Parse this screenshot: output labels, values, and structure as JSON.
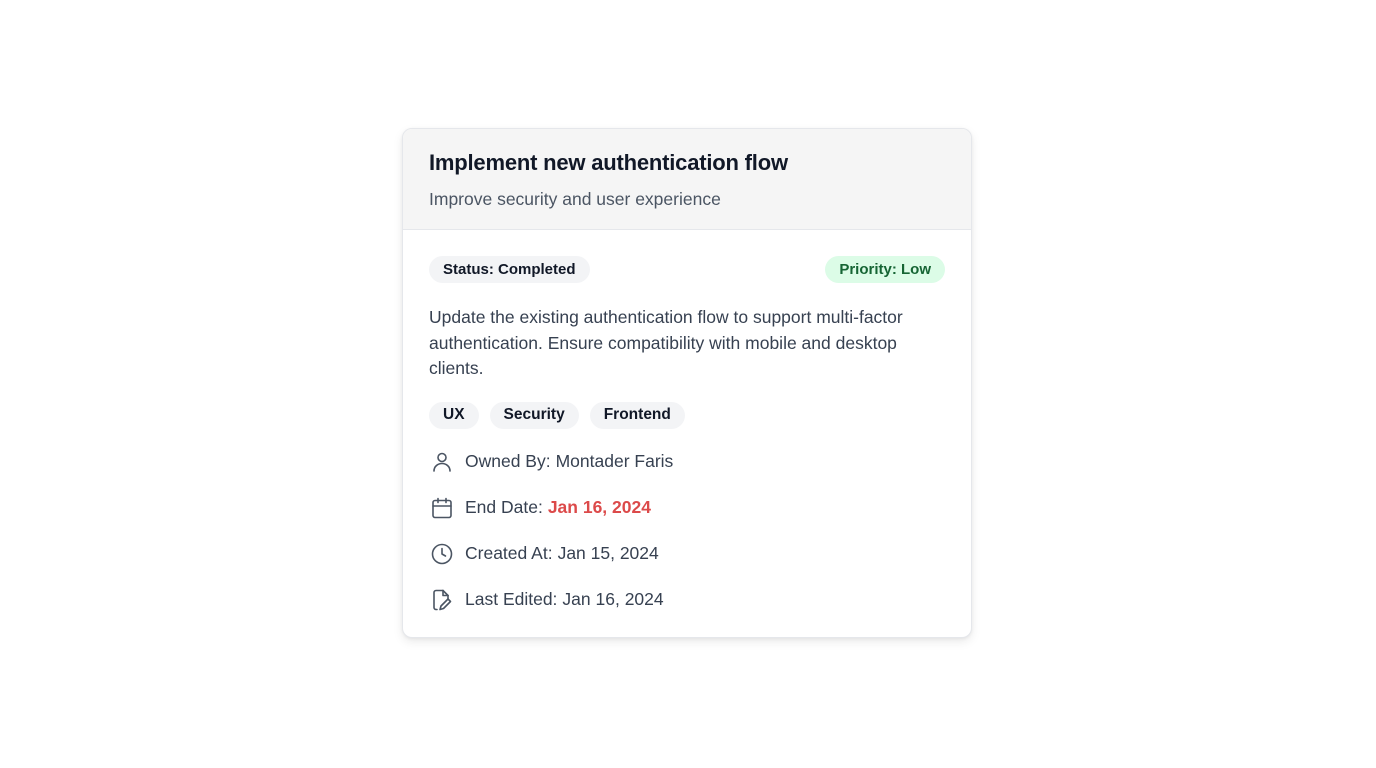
{
  "card": {
    "title": "Implement new authentication flow",
    "subtitle": "Improve security and user experience",
    "status": "Status: Completed",
    "priority": "Priority: Low",
    "description": "Update the existing authentication flow to support multi-factor authentication. Ensure compatibility with mobile and desktop clients.",
    "tags": [
      "UX",
      "Security",
      "Frontend"
    ],
    "owner": {
      "label": "Owned By:",
      "value": "Montader Faris"
    },
    "end_date": {
      "label": "End Date:",
      "value": "Jan 16, 2024",
      "color": "#dc4a4a"
    },
    "created_at": {
      "label": "Created At:",
      "value": "Jan 15, 2024"
    },
    "last_edited": {
      "label": "Last Edited:",
      "value": "Jan 16, 2024"
    }
  },
  "icons": {
    "owner": "user-icon",
    "end_date": "calendar-icon",
    "created_at": "clock-icon",
    "last_edited": "file-edit-icon"
  },
  "colors": {
    "priority_bg": "#dcfce7",
    "priority_text": "#166534",
    "status_bg": "#f3f4f6",
    "header_bg": "#f5f5f5"
  }
}
